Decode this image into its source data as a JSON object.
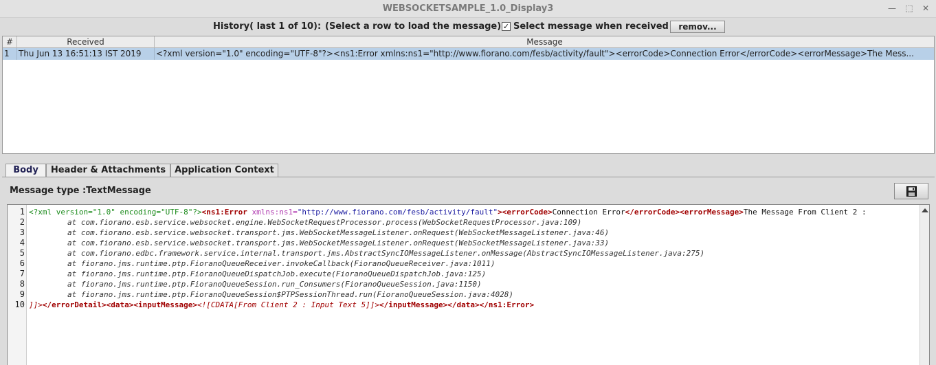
{
  "window": {
    "title": "WEBSOCKETSAMPLE_1.0_Display3",
    "controls": {
      "minimize": "—",
      "maximize": "⬚",
      "close": "✕"
    }
  },
  "history": {
    "label": "History( last 1 of 10):",
    "hint": "(Select a row to load the message)",
    "checkbox_checked": true,
    "checkbox_mark": "✓",
    "checkbox_label": "Select message when received",
    "remove_label": "remov..."
  },
  "table": {
    "columns": [
      "#",
      "Received",
      "Message"
    ],
    "rows": [
      {
        "index": "1",
        "received": "Thu Jun 13 16:51:13 IST 2019",
        "message": "<?xml version=\"1.0\" encoding=\"UTF-8\"?><ns1:Error xmlns:ns1=\"http://www.fiorano.com/fesb/activity/fault\"><errorCode>Connection Error</errorCode><errorMessage>The Mess..."
      }
    ]
  },
  "tabs": [
    "Body",
    "Header & Attachments",
    "Application Context"
  ],
  "active_tab": "Body",
  "body": {
    "message_type": "Message type :TextMessage",
    "save_icon": "save-icon"
  },
  "editor": {
    "line_numbers": [
      "1",
      "2",
      "3",
      "4",
      "5",
      "6",
      "7",
      "8",
      "9",
      "10"
    ],
    "line1": {
      "pi": "<?xml version=\"1.0\" encoding=\"UTF-8\"?>",
      "tag_open_error": "<ns1:Error",
      "attr_name": " xmlns:ns1=",
      "attr_value": "\"http://www.fiorano.com/fesb/activity/fault\"",
      "gt": ">",
      "tag_errorcode_open": "<errorCode>",
      "errorcode_text": "Connection Error",
      "tag_errorcode_close": "</errorCode>",
      "tag_errormessage_open": "<errorMessage>",
      "errormessage_text": "The Message From Client 2 :"
    },
    "stack": [
      "at com.fiorano.esb.service.websocket.engine.WebSocketRequestProcessor.process(WebSocketRequestProcessor.java:109)",
      "at com.fiorano.esb.service.websocket.transport.jms.WebSocketMessageListener.onRequest(WebSocketMessageListener.java:46)",
      "at com.fiorano.esb.service.websocket.transport.jms.WebSocketMessageListener.onRequest(WebSocketMessageListener.java:33)",
      "at com.fiorano.edbc.framework.service.internal.transport.jms.AbstractSyncIOMessageListener.onMessage(AbstractSyncIOMessageListener.java:275)",
      "at fiorano.jms.runtime.ptp.FioranoQueueReceiver.invokeCallback(FioranoQueueReceiver.java:1011)",
      "at fiorano.jms.runtime.ptp.FioranoQueueDispatchJob.execute(FioranoQueueDispatchJob.java:125)",
      "at fiorano.jms.runtime.ptp.FioranoQueueSession.run_Consumers(FioranoQueueSession.java:1150)",
      "at fiorano.jms.runtime.ptp.FioranoQueueSession$PTPSessionThread.run(FioranoQueueSession.java:4028)"
    ],
    "line10": {
      "cdata_end": "]]>",
      "tags1": "</errorDetail><data><inputMessage>",
      "cdata": "<![CDATA[From Client 2 : Input Text 5]]>",
      "tags2": "</inputMessage></data></ns1:Error>"
    }
  }
}
